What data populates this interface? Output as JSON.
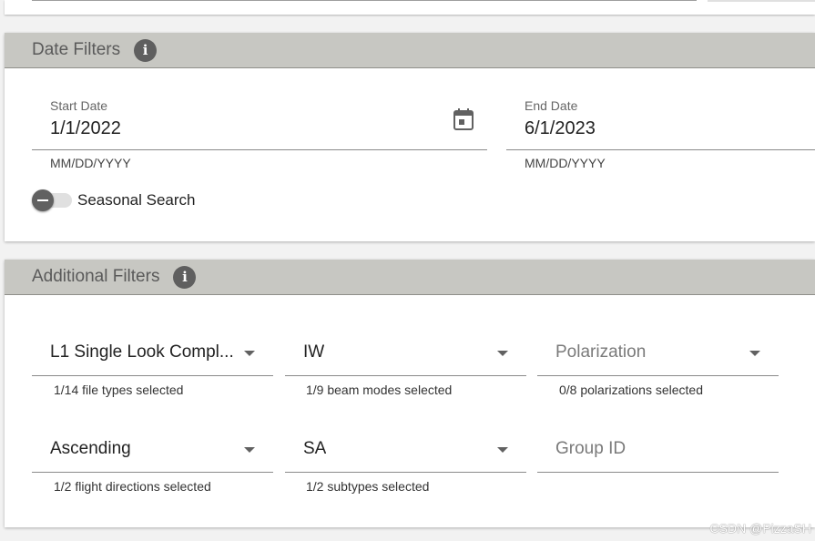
{
  "date_filters": {
    "title": "Date Filters",
    "start_date": {
      "label": "Start Date",
      "value": "1/1/2022",
      "hint": "MM/DD/YYYY"
    },
    "end_date": {
      "label": "End Date",
      "value": "6/1/2023",
      "hint": "MM/DD/YYYY"
    },
    "seasonal_search": {
      "label": "Seasonal Search",
      "enabled": false
    }
  },
  "additional_filters": {
    "title": "Additional Filters",
    "file_type": {
      "value": "L1 Single Look Compl...",
      "hint": "1/14 file types selected"
    },
    "beam_mode": {
      "value": "IW",
      "hint": "1/9 beam modes selected"
    },
    "polarization": {
      "placeholder": "Polarization",
      "hint": "0/8 polarizations selected"
    },
    "flight_direction": {
      "value": "Ascending",
      "hint": "1/2 flight directions selected"
    },
    "subtype": {
      "value": "SA",
      "hint": "1/2 subtypes selected"
    },
    "group_id": {
      "placeholder": "Group ID"
    }
  },
  "watermark": "CSDN @PizzaSH",
  "icons": {
    "info": "info-icon",
    "calendar": "calendar-icon",
    "dropdown": "chevron-down-icon"
  }
}
